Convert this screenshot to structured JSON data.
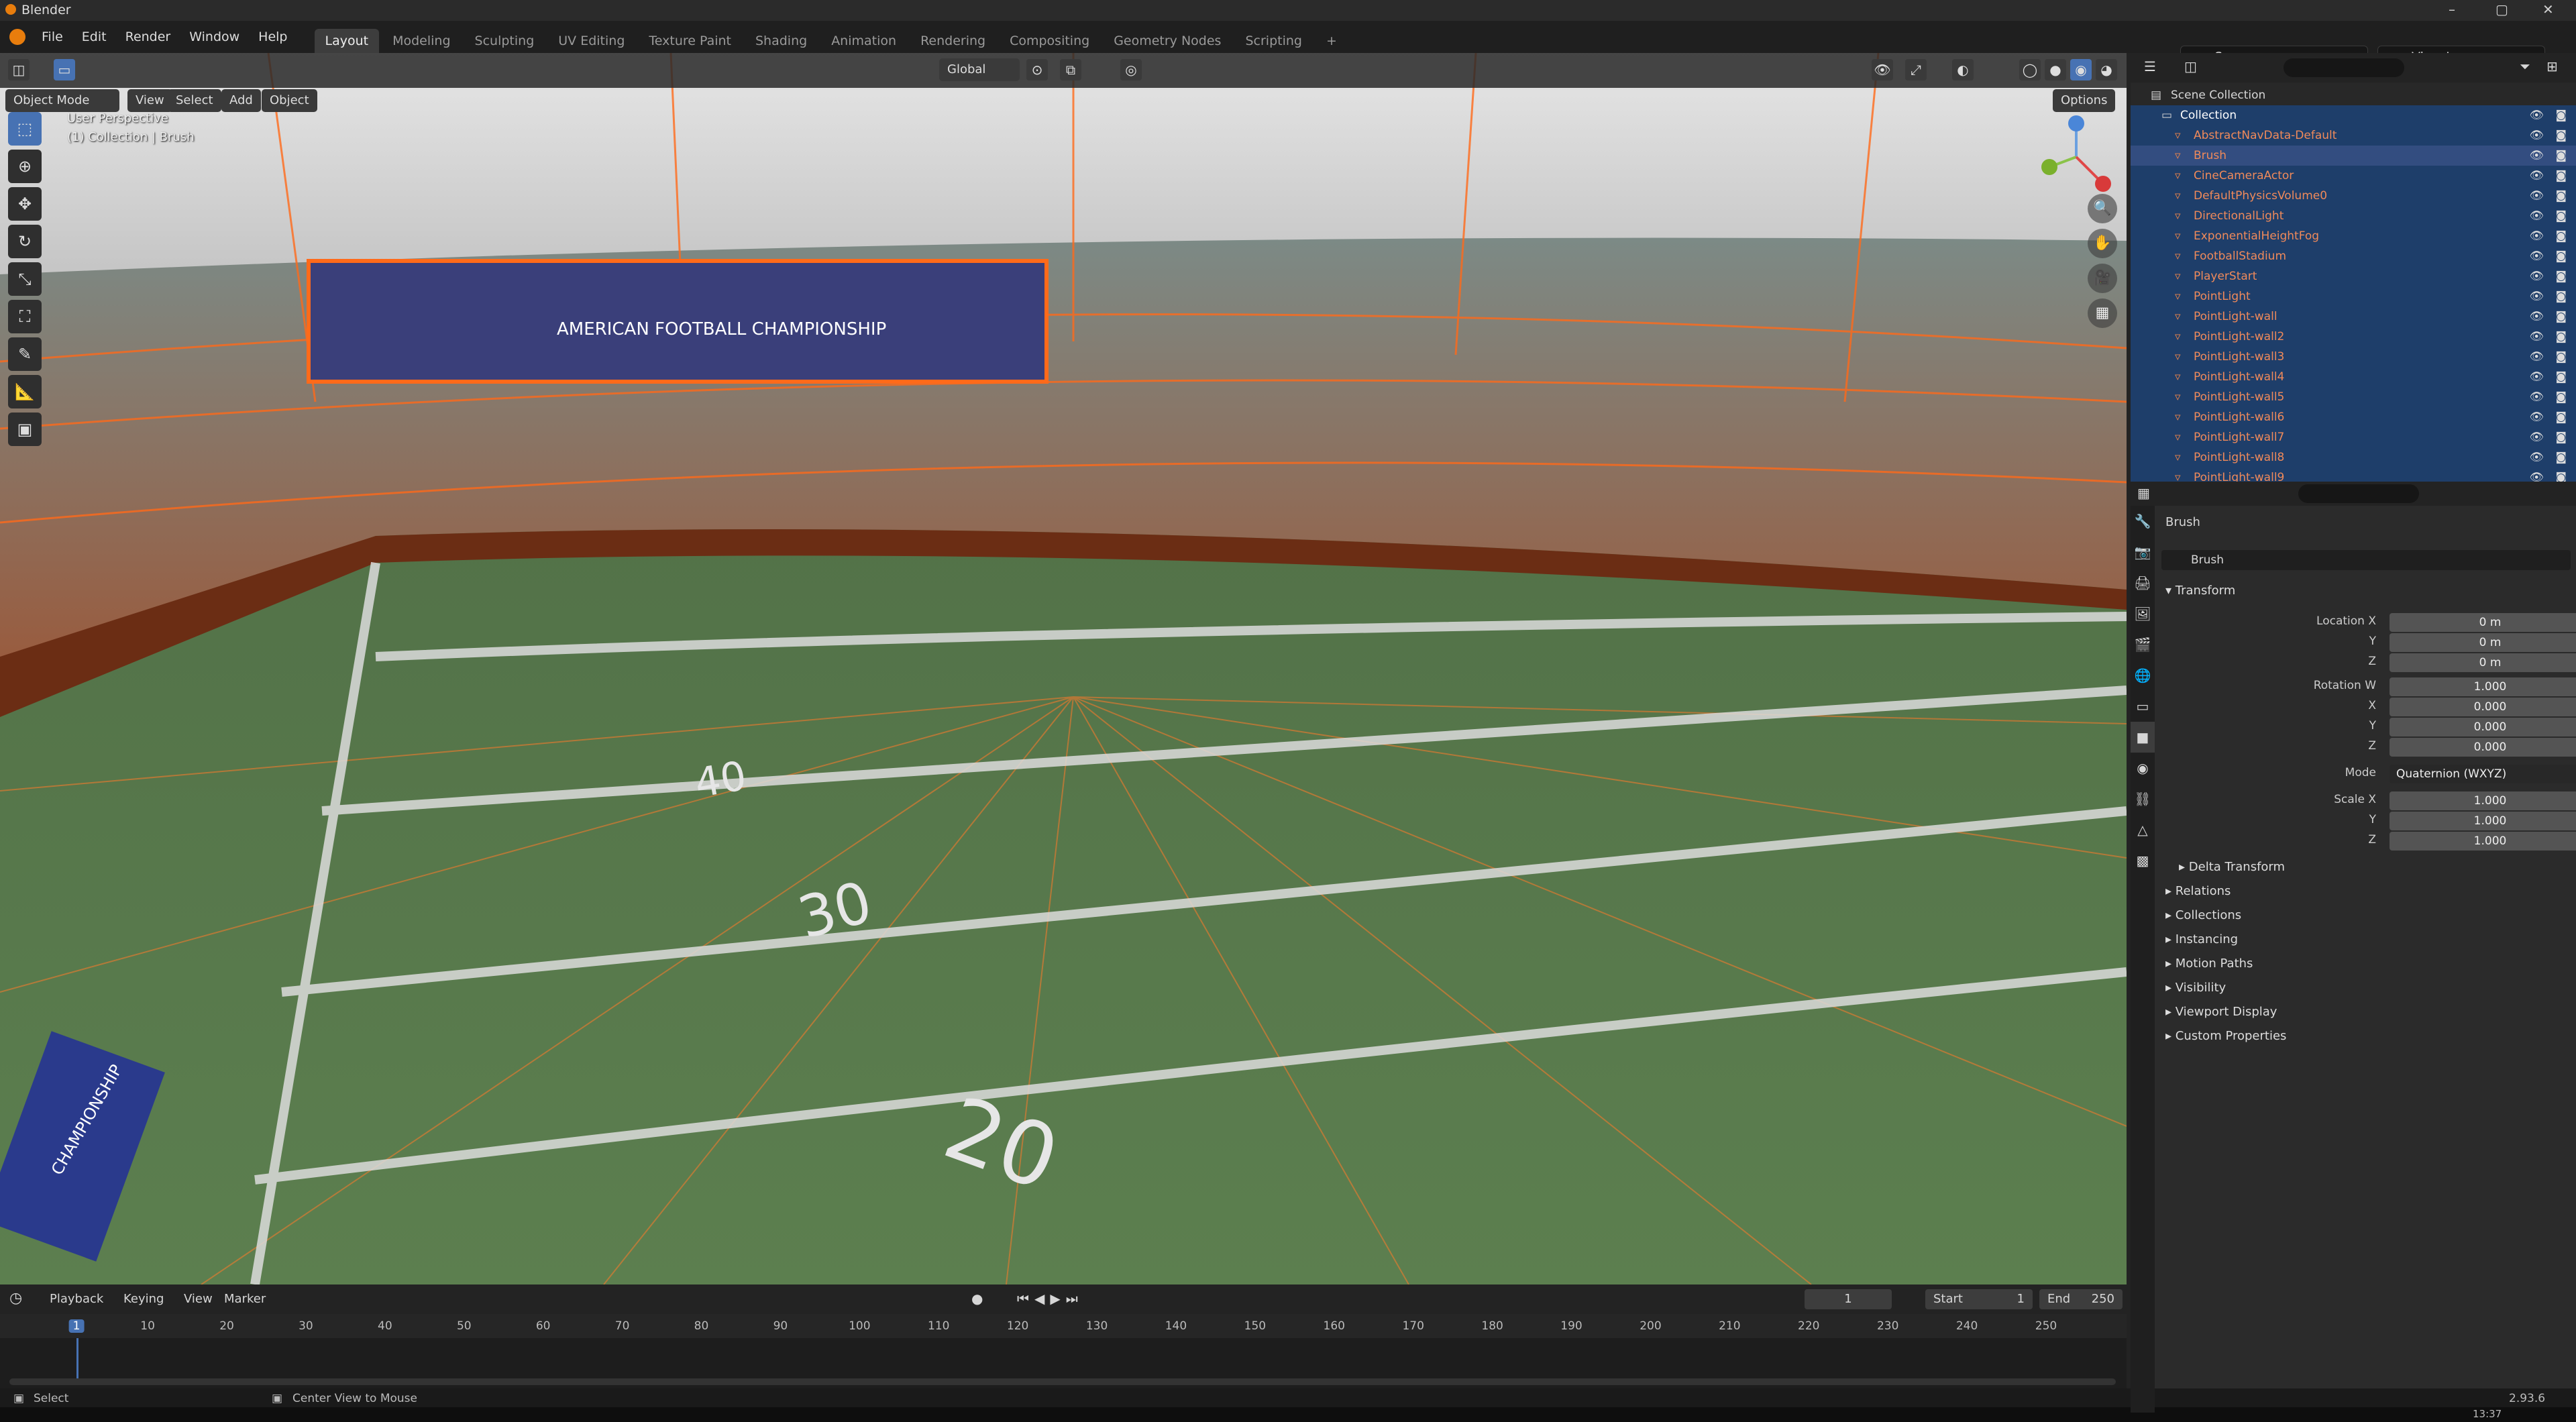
{
  "window": {
    "title": "Blender",
    "minimize": "–",
    "maximize": "▢",
    "close": "✕"
  },
  "menu": [
    "File",
    "Edit",
    "Render",
    "Window",
    "Help"
  ],
  "workspaces": [
    "Layout",
    "Modeling",
    "Sculpting",
    "UV Editing",
    "Texture Paint",
    "Shading",
    "Animation",
    "Rendering",
    "Compositing",
    "Geometry Nodes",
    "Scripting"
  ],
  "workspace_add": "+",
  "scene": "Scene",
  "view_layer": "View Layer",
  "viewport": {
    "mode": "Object Mode",
    "menus": [
      "View",
      "Select",
      "Add",
      "Object"
    ],
    "orientation": "Global",
    "options": "Options",
    "info_line1": "User Perspective",
    "info_line2": "(1) Collection | Brush",
    "field_numbers": [
      "40",
      "30",
      "20"
    ],
    "banner": "AMERICAN FOOTBALL CHAMPIONSHIP",
    "sign": "CHAMPIONSHIP"
  },
  "outliner": {
    "root": "Scene Collection",
    "collection": "Collection",
    "items": [
      "AbstractNavData-Default",
      "Brush",
      "CineCameraActor",
      "DefaultPhysicsVolume0",
      "DirectionalLight",
      "ExponentialHeightFog",
      "FootballStadium",
      "PlayerStart",
      "PointLight",
      "PointLight-wall",
      "PointLight-wall2",
      "PointLight-wall3",
      "PointLight-wall4",
      "PointLight-wall5",
      "PointLight-wall6",
      "PointLight-wall7",
      "PointLight-wall8",
      "PointLight-wall9"
    ]
  },
  "properties": {
    "object_name": "Brush",
    "data_name": "Brush",
    "transform": "Transform",
    "location_label": "Location X",
    "loc": [
      "0 m",
      "0 m",
      "0 m"
    ],
    "rotation_label": "Rotation W",
    "rot": [
      "1.000",
      "0.000",
      "0.000",
      "0.000"
    ],
    "axis": [
      "Y",
      "Z",
      "X"
    ],
    "mode_label": "Mode",
    "mode": "Quaternion (WXYZ)",
    "scale_label": "Scale X",
    "scale": [
      "1.000",
      "1.000",
      "1.000"
    ],
    "sections": [
      "Delta Transform",
      "Relations",
      "Collections",
      "Instancing",
      "Motion Paths",
      "Visibility",
      "Viewport Display",
      "Custom Properties"
    ]
  },
  "timeline": {
    "menus": [
      "Playback",
      "Keying",
      "View",
      "Marker"
    ],
    "current": "1",
    "start_label": "Start",
    "start": "1",
    "end_label": "End",
    "end": "250",
    "ticks": [
      "1",
      "10",
      "20",
      "30",
      "40",
      "50",
      "60",
      "70",
      "80",
      "90",
      "100",
      "110",
      "120",
      "130",
      "140",
      "150",
      "160",
      "170",
      "180",
      "190",
      "200",
      "210",
      "220",
      "230",
      "240",
      "250"
    ]
  },
  "status": {
    "left": "Select",
    "mid": "Center View to Mouse",
    "time": "13:37",
    "version": "2.93.6"
  }
}
